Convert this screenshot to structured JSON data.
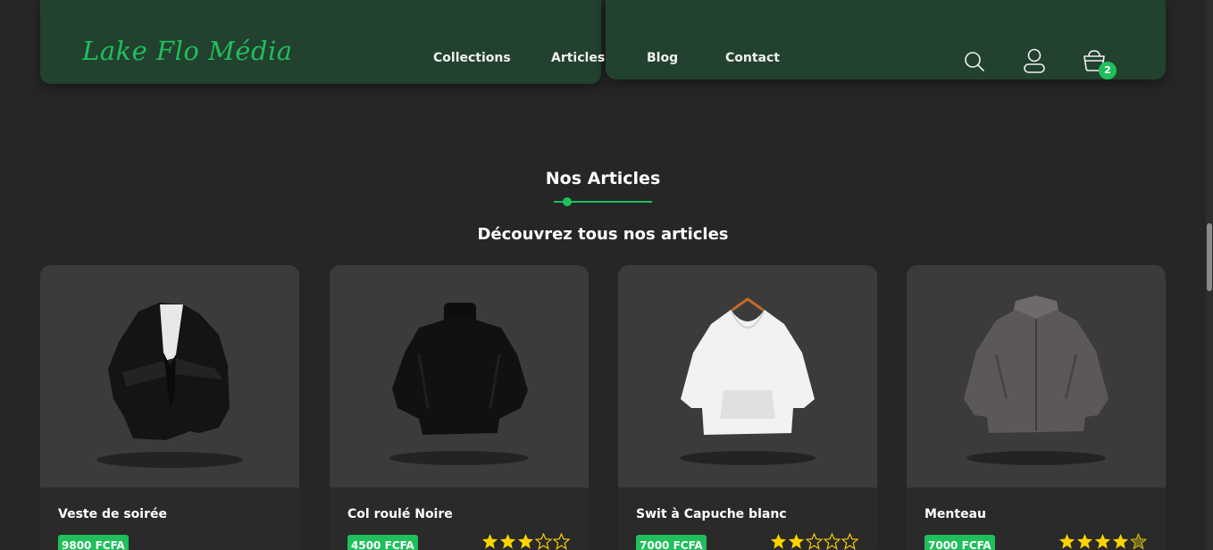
{
  "brand": {
    "logo": "Lake Flo Média",
    "accent": "#1fbf5b",
    "nav_bg": "#22412f"
  },
  "nav": {
    "links": [
      "Collections",
      "Articles",
      "Blog",
      "Contact"
    ],
    "cart_count": "2",
    "icons": [
      "search-icon",
      "user-icon",
      "cart-icon"
    ]
  },
  "section": {
    "title": "Nos Articles",
    "subtitle": "Découvrez tous nos articles"
  },
  "products": [
    {
      "name": "Veste de soirée",
      "price": "9800 FCFA",
      "rating": null
    },
    {
      "name": "Col roulé Noire",
      "price": "4500 FCFA",
      "rating": 3
    },
    {
      "name": "Swit à Capuche blanc",
      "price": "7000 FCFA",
      "rating": 2
    },
    {
      "name": "Menteau",
      "price": "7000 FCFA",
      "rating": 4
    }
  ]
}
